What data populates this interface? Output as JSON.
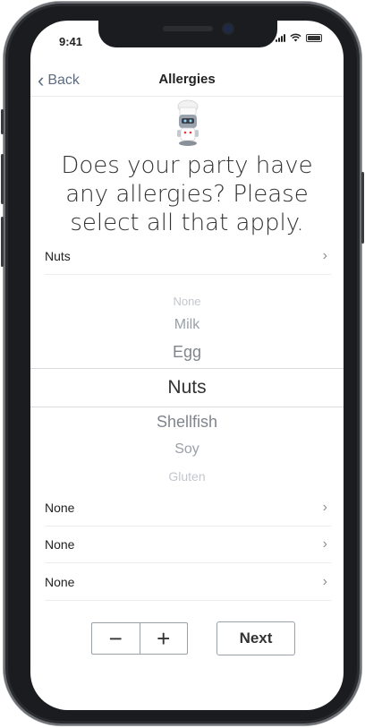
{
  "status_bar": {
    "time": "9:41"
  },
  "navbar": {
    "back_label": "Back",
    "title": "Allergies"
  },
  "question": "Does your party have any allergies? Please select all that apply.",
  "rows": [
    {
      "value": "Nuts"
    },
    {
      "value": "None"
    },
    {
      "value": "None"
    },
    {
      "value": "None"
    }
  ],
  "picker": {
    "options": [
      "None",
      "Milk",
      "Egg",
      "Nuts",
      "Shellfish",
      "Soy",
      "Gluten"
    ],
    "selected": "Nuts"
  },
  "stepper": {
    "minus": "−",
    "plus": "+"
  },
  "next_label": "Next",
  "icons": {
    "back": "chevron-left-icon",
    "row": "chevron-right-icon",
    "mascot": "chef-robot-icon"
  },
  "colors": {
    "accent": "#5c6b80",
    "text": "#333333"
  }
}
